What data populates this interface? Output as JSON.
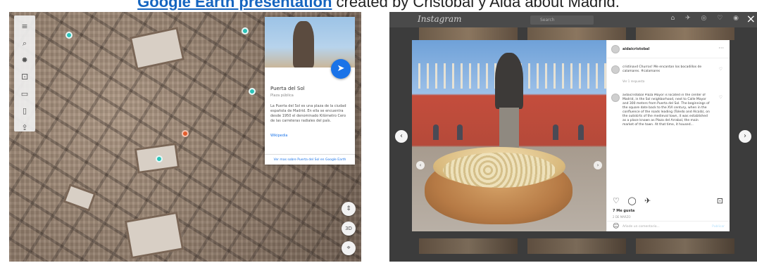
{
  "caption": {
    "link_text": "Google Earth presentation",
    "rest_text": " created by Cristobal y Aida about Madrid."
  },
  "earth": {
    "toolbar_icons": [
      "menu-icon",
      "search-icon",
      "voyager-icon",
      "feeling-lucky-icon",
      "projects-icon",
      "measure-icon",
      "share-icon"
    ],
    "toolbar_glyphs": [
      "≡",
      "⌕",
      "✹",
      "⚀",
      "▭",
      "▯",
      "⇪"
    ],
    "info_card": {
      "title": "Puerta del Sol",
      "subtitle": "Plaza pública",
      "description": "La Puerta del Sol es una plaza de la ciudad española de Madrid. En ella se encuentra desde 1950 el denominado Kilómetro Cero de las carreteras radiales del país.",
      "link": "Wikipedia",
      "footer": "Ver mas sobre Puerta del Sol en Google Earth",
      "fab_glyph": "➤"
    },
    "controls": [
      "⇕",
      "3D",
      "⌖"
    ]
  },
  "instagram": {
    "logo": "Instagram",
    "search_placeholder": "Search",
    "header_icons": "⌂ ✈ ◎ ♡ ◉",
    "close": "×",
    "nav_prev": "‹",
    "nav_next": "›",
    "post": {
      "username": "aidaicristobal",
      "more": "···",
      "first_comment": "cristinavd Churros! Me encantan los bocadillos de calamares. #calamares",
      "first_meta": "Ver 1 respuesta",
      "caption": "aidaicristobal Plaza Mayor is located in the center of Madrid, in the Sol neighborhood, next to Calle Mayor and 300 meters from Puerta del Sol. The beginnings of the square date back to the XVI century, when in the confluence of the roads leading (Toledo and Alcalá), on the outskirts of the medieval town, it was established as a place known as Plaza del Arrabal, the main market of the town. At that time, it housed...",
      "actions": "♡ ◯ ✈",
      "bookmark": "⊡",
      "likes": "7 Me gusta",
      "date": "2 DE MARZO",
      "add_comment_placeholder": "Añade un comentario...",
      "publish": "Publicar",
      "emoji": "☺"
    }
  }
}
